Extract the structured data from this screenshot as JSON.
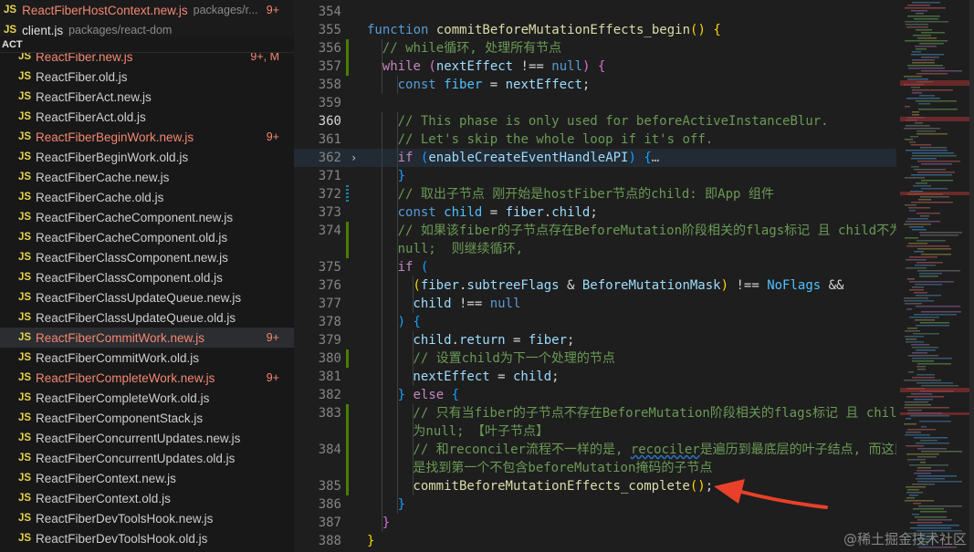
{
  "sidebar": {
    "sticky_rows": [
      {
        "badge": "JS",
        "name": "ReactFiberHostContext.new.js",
        "path": "packages/r...",
        "status": "9+",
        "modified": true
      },
      {
        "badge": "JS",
        "name": "client.js",
        "path": "packages/react-dom",
        "status": "",
        "modified": false
      }
    ],
    "section_label": "ACT",
    "files": [
      {
        "name": "ReactFiber.new.js",
        "status": "9+, M",
        "modified": true,
        "active": false
      },
      {
        "name": "ReactFiber.old.js",
        "status": "",
        "modified": false,
        "active": false
      },
      {
        "name": "ReactFiberAct.new.js",
        "status": "",
        "modified": false,
        "active": false
      },
      {
        "name": "ReactFiberAct.old.js",
        "status": "",
        "modified": false,
        "active": false
      },
      {
        "name": "ReactFiberBeginWork.new.js",
        "status": "9+",
        "modified": true,
        "active": false
      },
      {
        "name": "ReactFiberBeginWork.old.js",
        "status": "",
        "modified": false,
        "active": false
      },
      {
        "name": "ReactFiberCache.new.js",
        "status": "",
        "modified": false,
        "active": false
      },
      {
        "name": "ReactFiberCache.old.js",
        "status": "",
        "modified": false,
        "active": false
      },
      {
        "name": "ReactFiberCacheComponent.new.js",
        "status": "",
        "modified": false,
        "active": false
      },
      {
        "name": "ReactFiberCacheComponent.old.js",
        "status": "",
        "modified": false,
        "active": false
      },
      {
        "name": "ReactFiberClassComponent.new.js",
        "status": "",
        "modified": false,
        "active": false
      },
      {
        "name": "ReactFiberClassComponent.old.js",
        "status": "",
        "modified": false,
        "active": false
      },
      {
        "name": "ReactFiberClassUpdateQueue.new.js",
        "status": "",
        "modified": false,
        "active": false
      },
      {
        "name": "ReactFiberClassUpdateQueue.old.js",
        "status": "",
        "modified": false,
        "active": false
      },
      {
        "name": "ReactFiberCommitWork.new.js",
        "status": "9+",
        "modified": true,
        "active": true
      },
      {
        "name": "ReactFiberCommitWork.old.js",
        "status": "",
        "modified": false,
        "active": false
      },
      {
        "name": "ReactFiberCompleteWork.new.js",
        "status": "9+",
        "modified": true,
        "active": false
      },
      {
        "name": "ReactFiberCompleteWork.old.js",
        "status": "",
        "modified": false,
        "active": false
      },
      {
        "name": "ReactFiberComponentStack.js",
        "status": "",
        "modified": false,
        "active": false
      },
      {
        "name": "ReactFiberConcurrentUpdates.new.js",
        "status": "",
        "modified": false,
        "active": false
      },
      {
        "name": "ReactFiberConcurrentUpdates.old.js",
        "status": "",
        "modified": false,
        "active": false
      },
      {
        "name": "ReactFiberContext.new.js",
        "status": "",
        "modified": false,
        "active": false
      },
      {
        "name": "ReactFiberContext.old.js",
        "status": "",
        "modified": false,
        "active": false
      },
      {
        "name": "ReactFiberDevToolsHook.new.js",
        "status": "",
        "modified": false,
        "active": false
      },
      {
        "name": "ReactFiberDevToolsHook.old.js",
        "status": "",
        "modified": false,
        "active": false
      }
    ]
  },
  "editor": {
    "current_line": "360",
    "lines": [
      {
        "ln": "354",
        "indent": 0,
        "tokens": []
      },
      {
        "ln": "355",
        "indent": 0,
        "tokens": [
          [
            "k-kw",
            "function "
          ],
          [
            "k-fn",
            "commitBeforeMutationEffects_begin"
          ],
          [
            "k-brk1",
            "()"
          ],
          [
            "k-txt",
            " "
          ],
          [
            "k-brk1",
            "{"
          ]
        ]
      },
      {
        "ln": "356",
        "indent": 1,
        "gutter": "add",
        "tokens": [
          [
            "k-com",
            "// while循环, 处理所有节点"
          ]
        ]
      },
      {
        "ln": "357",
        "indent": 1,
        "gutter": "add",
        "tokens": [
          [
            "k-ctrl",
            "while"
          ],
          [
            "k-txt",
            " "
          ],
          [
            "k-brk2",
            "("
          ],
          [
            "k-var",
            "nextEffect"
          ],
          [
            "k-txt",
            " !== "
          ],
          [
            "k-kw",
            "null"
          ],
          [
            "k-brk2",
            ")"
          ],
          [
            "k-txt",
            " "
          ],
          [
            "k-brk2",
            "{"
          ]
        ]
      },
      {
        "ln": "358",
        "indent": 2,
        "tokens": [
          [
            "k-kw",
            "const "
          ],
          [
            "k-const",
            "fiber"
          ],
          [
            "k-txt",
            " = "
          ],
          [
            "k-var",
            "nextEffect"
          ],
          [
            "k-txt",
            ";"
          ]
        ]
      },
      {
        "ln": "359",
        "indent": 0,
        "tokens": []
      },
      {
        "ln": "360",
        "indent": 2,
        "current": true,
        "tokens": [
          [
            "k-com",
            "// This phase is only used for beforeActiveInstanceBlur."
          ]
        ]
      },
      {
        "ln": "361",
        "indent": 2,
        "tokens": [
          [
            "k-com",
            "// Let's skip the whole loop if it's off."
          ]
        ]
      },
      {
        "ln": "362",
        "indent": 2,
        "fold": "›",
        "current_bg": true,
        "tokens": [
          [
            "k-ctrl",
            "if"
          ],
          [
            "k-txt",
            " "
          ],
          [
            "k-brk3",
            "("
          ],
          [
            "k-var",
            "enableCreateEventHandleAPI"
          ],
          [
            "k-brk3",
            ")"
          ],
          [
            "k-txt",
            " "
          ],
          [
            "k-brk3",
            "{"
          ],
          [
            "k-fold",
            "…"
          ]
        ]
      },
      {
        "ln": "371",
        "indent": 2,
        "tokens": [
          [
            "k-brk3",
            "}"
          ]
        ]
      },
      {
        "ln": "372",
        "indent": 2,
        "gutter": "mod",
        "tokens": [
          [
            "k-com",
            "// 取出子节点 刚开始是hostFiber节点的child: 即App 组件"
          ]
        ]
      },
      {
        "ln": "373",
        "indent": 2,
        "tokens": [
          [
            "k-kw",
            "const "
          ],
          [
            "k-const",
            "child"
          ],
          [
            "k-txt",
            " = "
          ],
          [
            "k-var",
            "fiber"
          ],
          [
            "k-txt",
            "."
          ],
          [
            "k-var",
            "child"
          ],
          [
            "k-txt",
            ";"
          ]
        ]
      },
      {
        "ln": "374",
        "indent": 2,
        "gutter": "add",
        "tokens": [
          [
            "k-com",
            "// 如果该fiber的子节点存在BeforeMutation阶段相关的flags标记 且 child不为"
          ]
        ]
      },
      {
        "ln": "",
        "indent": 2,
        "gutter": "add",
        "wrap": true,
        "tokens": [
          [
            "k-com",
            "null;  则继续循环,"
          ]
        ]
      },
      {
        "ln": "375",
        "indent": 2,
        "tokens": [
          [
            "k-ctrl",
            "if"
          ],
          [
            "k-txt",
            " "
          ],
          [
            "k-brk3",
            "("
          ]
        ]
      },
      {
        "ln": "376",
        "indent": 3,
        "tokens": [
          [
            "k-brk1",
            "("
          ],
          [
            "k-var",
            "fiber"
          ],
          [
            "k-txt",
            "."
          ],
          [
            "k-var",
            "subtreeFlags"
          ],
          [
            "k-txt",
            " & "
          ],
          [
            "k-var",
            "BeforeMutationMask"
          ],
          [
            "k-brk1",
            ")"
          ],
          [
            "k-txt",
            " !== "
          ],
          [
            "k-const",
            "NoFlags"
          ],
          [
            "k-txt",
            " &&"
          ]
        ]
      },
      {
        "ln": "377",
        "indent": 3,
        "tokens": [
          [
            "k-var",
            "child"
          ],
          [
            "k-txt",
            " !== "
          ],
          [
            "k-kw",
            "null"
          ]
        ]
      },
      {
        "ln": "378",
        "indent": 2,
        "tokens": [
          [
            "k-brk3",
            ")"
          ],
          [
            "k-txt",
            " "
          ],
          [
            "k-brk3",
            "{"
          ]
        ]
      },
      {
        "ln": "379",
        "indent": 3,
        "tokens": [
          [
            "k-var",
            "child"
          ],
          [
            "k-txt",
            "."
          ],
          [
            "k-var",
            "return"
          ],
          [
            "k-txt",
            " = "
          ],
          [
            "k-var",
            "fiber"
          ],
          [
            "k-txt",
            ";"
          ]
        ]
      },
      {
        "ln": "380",
        "indent": 3,
        "gutter": "add",
        "tokens": [
          [
            "k-com",
            "// 设置child为下一个处理的节点"
          ]
        ]
      },
      {
        "ln": "381",
        "indent": 3,
        "tokens": [
          [
            "k-var",
            "nextEffect"
          ],
          [
            "k-txt",
            " = "
          ],
          [
            "k-var",
            "child"
          ],
          [
            "k-txt",
            ";"
          ]
        ]
      },
      {
        "ln": "382",
        "indent": 2,
        "tokens": [
          [
            "k-brk3",
            "}"
          ],
          [
            "k-txt",
            " "
          ],
          [
            "k-ctrl",
            "else"
          ],
          [
            "k-txt",
            " "
          ],
          [
            "k-brk3",
            "{"
          ]
        ]
      },
      {
        "ln": "383",
        "indent": 3,
        "gutter": "add",
        "tokens": [
          [
            "k-com",
            "// 只有当fiber的子节点不存在BeforeMutation阶段相关的flags标记 且 child"
          ]
        ]
      },
      {
        "ln": "",
        "indent": 3,
        "gutter": "add",
        "wrap": true,
        "tokens": [
          [
            "k-com",
            "为null; 【叶子节点】"
          ]
        ]
      },
      {
        "ln": "384",
        "indent": 3,
        "gutter": "add",
        "tokens": [
          [
            "k-com",
            "// 和reconciler流程不一样的是, "
          ],
          [
            "k-under",
            "recociler"
          ],
          [
            "k-com",
            "是遍历到最底层的叶子结点, 而这里"
          ]
        ]
      },
      {
        "ln": "",
        "indent": 3,
        "gutter": "add",
        "wrap": true,
        "tokens": [
          [
            "k-com",
            "是找到第一个不包含beforeMutation掩码的子节点"
          ]
        ]
      },
      {
        "ln": "385",
        "indent": 3,
        "gutter": "add",
        "tokens": [
          [
            "k-fn",
            "commitBeforeMutationEffects_complete"
          ],
          [
            "k-brk1",
            "()"
          ],
          [
            "k-txt",
            ";"
          ]
        ]
      },
      {
        "ln": "386",
        "indent": 2,
        "tokens": [
          [
            "k-brk3",
            "}"
          ]
        ]
      },
      {
        "ln": "387",
        "indent": 1,
        "tokens": [
          [
            "k-brk2",
            "}"
          ]
        ]
      },
      {
        "ln": "388",
        "indent": 0,
        "tokens": [
          [
            "k-brk1",
            "}"
          ]
        ]
      }
    ]
  },
  "watermark": "@稀土掘金技术社区",
  "colors": {
    "arrow": "#e8402a",
    "accent_modified": "#f48771",
    "js_badge": "#e8d44d"
  }
}
